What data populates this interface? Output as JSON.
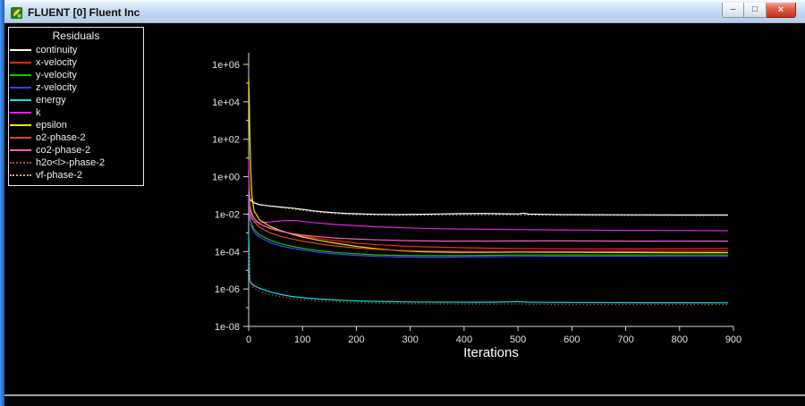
{
  "window": {
    "title": "FLUENT [0] Fluent Inc",
    "controls": {
      "minimize": "–",
      "maximize": "□",
      "close": "×"
    }
  },
  "legend": {
    "title": "Residuals",
    "items": [
      {
        "label": "continuity",
        "color": "#ffffff",
        "dash": "solid"
      },
      {
        "label": "x-velocity",
        "color": "#ff2222",
        "dash": "solid"
      },
      {
        "label": "y-velocity",
        "color": "#00cc00",
        "dash": "solid"
      },
      {
        "label": "z-velocity",
        "color": "#4040ff",
        "dash": "solid"
      },
      {
        "label": "energy",
        "color": "#00e5e5",
        "dash": "solid"
      },
      {
        "label": "k",
        "color": "#e320e3",
        "dash": "solid"
      },
      {
        "label": "epsilon",
        "color": "#e8e800",
        "dash": "solid"
      },
      {
        "label": "o2-phase-2",
        "color": "#e0481c",
        "dash": "solid"
      },
      {
        "label": "co2-phase-2",
        "color": "#f060c0",
        "dash": "solid"
      },
      {
        "label": "h2o<l>-phase-2",
        "color": "#b04838",
        "dash": "dotted"
      },
      {
        "label": "vf-phase-2",
        "color": "#c8a878",
        "dash": "dotted"
      }
    ]
  },
  "chart_data": {
    "type": "line",
    "title": "Residuals",
    "xlabel": "Iterations",
    "ylabel": "",
    "x_range": [
      0,
      900
    ],
    "ylog_range": [
      -8,
      6
    ],
    "x_ticks": [
      0,
      100,
      200,
      300,
      400,
      500,
      600,
      700,
      800,
      900
    ],
    "y_ticks": [
      "1e+06",
      "1e+04",
      "1e+02",
      "1e+00",
      "1e-02",
      "1e-04",
      "1e-06",
      "1e-08"
    ],
    "grid": false,
    "legend_position": "top-left",
    "series": [
      {
        "name": "continuity",
        "color": "#ffffff",
        "style": "solid",
        "points": [
          [
            0,
            2
          ],
          [
            2,
            0.06
          ],
          [
            5,
            0.05
          ],
          [
            10,
            0.04
          ],
          [
            20,
            0.032
          ],
          [
            40,
            0.027
          ],
          [
            60,
            0.024
          ],
          [
            80,
            0.021
          ],
          [
            100,
            0.018
          ],
          [
            120,
            0.015
          ],
          [
            140,
            0.013
          ],
          [
            160,
            0.012
          ],
          [
            180,
            0.011
          ],
          [
            200,
            0.0105
          ],
          [
            240,
            0.0097
          ],
          [
            280,
            0.0095
          ],
          [
            320,
            0.0098
          ],
          [
            360,
            0.0102
          ],
          [
            400,
            0.0106
          ],
          [
            440,
            0.0108
          ],
          [
            480,
            0.0104
          ],
          [
            500,
            0.0102
          ],
          [
            510,
            0.0112
          ],
          [
            520,
            0.01
          ],
          [
            560,
            0.0096
          ],
          [
            600,
            0.0094
          ],
          [
            700,
            0.0092
          ],
          [
            800,
            0.009
          ],
          [
            890,
            0.009
          ]
        ]
      },
      {
        "name": "x-velocity",
        "color": "#ff2222",
        "style": "solid",
        "points": [
          [
            0,
            1
          ],
          [
            2,
            0.03
          ],
          [
            5,
            0.012
          ],
          [
            10,
            0.006
          ],
          [
            20,
            0.003
          ],
          [
            40,
            0.0018
          ],
          [
            60,
            0.0012
          ],
          [
            80,
            0.0009
          ],
          [
            100,
            0.0007
          ],
          [
            130,
            0.0005
          ],
          [
            160,
            0.00038
          ],
          [
            200,
            0.00028
          ],
          [
            240,
            0.00023
          ],
          [
            280,
            0.0002
          ],
          [
            320,
            0.00018
          ],
          [
            360,
            0.00017
          ],
          [
            400,
            0.00016
          ],
          [
            450,
            0.00015
          ],
          [
            500,
            0.000145
          ],
          [
            550,
            0.00014
          ],
          [
            600,
            0.00014
          ],
          [
            700,
            0.000138
          ],
          [
            800,
            0.000142
          ],
          [
            890,
            0.000145
          ]
        ]
      },
      {
        "name": "y-velocity",
        "color": "#00cc00",
        "style": "solid",
        "points": [
          [
            0,
            0.5
          ],
          [
            2,
            0.008
          ],
          [
            5,
            0.003
          ],
          [
            10,
            0.0015
          ],
          [
            20,
            0.0008
          ],
          [
            40,
            0.0004
          ],
          [
            60,
            0.00026
          ],
          [
            80,
            0.00019
          ],
          [
            100,
            0.00015
          ],
          [
            130,
            0.00011
          ],
          [
            160,
            9e-05
          ],
          [
            200,
            7.5e-05
          ],
          [
            240,
            6.6e-05
          ],
          [
            280,
            6.2e-05
          ],
          [
            320,
            6e-05
          ],
          [
            360,
            6e-05
          ],
          [
            400,
            6.1e-05
          ],
          [
            450,
            6.3e-05
          ],
          [
            500,
            6.5e-05
          ],
          [
            600,
            6.6e-05
          ],
          [
            700,
            6.6e-05
          ],
          [
            800,
            6.5e-05
          ],
          [
            890,
            6.5e-05
          ]
        ]
      },
      {
        "name": "z-velocity",
        "color": "#4040ff",
        "style": "solid",
        "points": [
          [
            0,
            0.4
          ],
          [
            2,
            0.006
          ],
          [
            5,
            0.0022
          ],
          [
            10,
            0.0011
          ],
          [
            20,
            0.0006
          ],
          [
            40,
            0.0003
          ],
          [
            60,
            0.0002
          ],
          [
            80,
            0.00015
          ],
          [
            100,
            0.00012
          ],
          [
            130,
            9e-05
          ],
          [
            160,
            7.5e-05
          ],
          [
            200,
            6.2e-05
          ],
          [
            240,
            5.5e-05
          ],
          [
            280,
            5.1e-05
          ],
          [
            320,
            5e-05
          ],
          [
            360,
            5e-05
          ],
          [
            400,
            5.1e-05
          ],
          [
            450,
            5.3e-05
          ],
          [
            500,
            5.5e-05
          ],
          [
            600,
            5.6e-05
          ],
          [
            700,
            5.6e-05
          ],
          [
            800,
            5.5e-05
          ],
          [
            890,
            5.5e-05
          ]
        ]
      },
      {
        "name": "energy",
        "color": "#00e5e5",
        "style": "solid",
        "points": [
          [
            0,
            0.001
          ],
          [
            2,
            3e-06
          ],
          [
            5,
            2e-06
          ],
          [
            10,
            1.5e-06
          ],
          [
            20,
            1.1e-06
          ],
          [
            40,
            7e-07
          ],
          [
            60,
            5e-07
          ],
          [
            80,
            4e-07
          ],
          [
            100,
            3.4e-07
          ],
          [
            130,
            2.9e-07
          ],
          [
            160,
            2.6e-07
          ],
          [
            200,
            2.3e-07
          ],
          [
            240,
            2.15e-07
          ],
          [
            280,
            2.05e-07
          ],
          [
            320,
            2e-07
          ],
          [
            360,
            1.97e-07
          ],
          [
            400,
            1.95e-07
          ],
          [
            450,
            1.95e-07
          ],
          [
            500,
            2.1e-07
          ],
          [
            520,
            1.95e-07
          ],
          [
            560,
            1.9e-07
          ],
          [
            600,
            1.88e-07
          ],
          [
            700,
            1.85e-07
          ],
          [
            800,
            1.82e-07
          ],
          [
            890,
            1.8e-07
          ]
        ]
      },
      {
        "name": "k",
        "color": "#e320e3",
        "style": "solid",
        "points": [
          [
            0,
            8
          ],
          [
            2,
            0.015
          ],
          [
            5,
            0.006
          ],
          [
            10,
            0.0042
          ],
          [
            20,
            0.0035
          ],
          [
            40,
            0.0038
          ],
          [
            60,
            0.0044
          ],
          [
            75,
            0.0047
          ],
          [
            90,
            0.0044
          ],
          [
            110,
            0.0038
          ],
          [
            130,
            0.0033
          ],
          [
            160,
            0.0028
          ],
          [
            200,
            0.0024
          ],
          [
            240,
            0.0021
          ],
          [
            280,
            0.0019
          ],
          [
            320,
            0.00175
          ],
          [
            360,
            0.00165
          ],
          [
            400,
            0.0016
          ],
          [
            450,
            0.00155
          ],
          [
            500,
            0.0015
          ],
          [
            550,
            0.00145
          ],
          [
            600,
            0.0014
          ],
          [
            650,
            0.00137
          ],
          [
            700,
            0.00135
          ],
          [
            800,
            0.00132
          ],
          [
            890,
            0.0013
          ]
        ]
      },
      {
        "name": "epsilon",
        "color": "#e8e800",
        "style": "solid",
        "points": [
          [
            0,
            200000
          ],
          [
            1,
            20000
          ],
          [
            2,
            300
          ],
          [
            4,
            2
          ],
          [
            6,
            0.1
          ],
          [
            10,
            0.015
          ],
          [
            20,
            0.005
          ],
          [
            40,
            0.0022
          ],
          [
            60,
            0.0013
          ],
          [
            80,
            0.00085
          ],
          [
            100,
            0.0006
          ],
          [
            130,
            0.0004
          ],
          [
            160,
            0.00028
          ],
          [
            200,
            0.00019
          ],
          [
            240,
            0.00014
          ],
          [
            280,
            0.00011
          ],
          [
            320,
            9.8e-05
          ],
          [
            360,
            9.2e-05
          ],
          [
            400,
            9e-05
          ],
          [
            450,
            9.1e-05
          ],
          [
            500,
            9.3e-05
          ],
          [
            550,
            9.2e-05
          ],
          [
            600,
            9e-05
          ],
          [
            700,
            8.8e-05
          ],
          [
            800,
            8.7e-05
          ],
          [
            890,
            8.7e-05
          ]
        ]
      },
      {
        "name": "o2-phase-2",
        "color": "#e0481c",
        "style": "solid",
        "points": [
          [
            0,
            0.3
          ],
          [
            2,
            0.02
          ],
          [
            5,
            0.008
          ],
          [
            10,
            0.004
          ],
          [
            20,
            0.002
          ],
          [
            40,
            0.001
          ],
          [
            60,
            0.00065
          ],
          [
            80,
            0.00047
          ],
          [
            100,
            0.00036
          ],
          [
            130,
            0.00026
          ],
          [
            160,
            0.0002
          ],
          [
            200,
            0.000155
          ],
          [
            240,
            0.00013
          ],
          [
            280,
            0.000115
          ],
          [
            320,
            0.000107
          ],
          [
            360,
            0.000103
          ],
          [
            400,
            0.000101
          ],
          [
            450,
            0.0001
          ],
          [
            500,
            0.000101
          ],
          [
            600,
            0.000102
          ],
          [
            700,
            0.000103
          ],
          [
            800,
            0.000104
          ],
          [
            890,
            0.000105
          ]
        ]
      },
      {
        "name": "co2-phase-2",
        "color": "#f060c0",
        "style": "solid",
        "points": [
          [
            0,
            0.2
          ],
          [
            2,
            0.03
          ],
          [
            5,
            0.012
          ],
          [
            10,
            0.006
          ],
          [
            20,
            0.003
          ],
          [
            40,
            0.0017
          ],
          [
            60,
            0.0012
          ],
          [
            80,
            0.00092
          ],
          [
            100,
            0.00076
          ],
          [
            130,
            0.00062
          ],
          [
            160,
            0.00053
          ],
          [
            200,
            0.00046
          ],
          [
            240,
            0.00042
          ],
          [
            280,
            0.00039
          ],
          [
            320,
            0.00037
          ],
          [
            360,
            0.00036
          ],
          [
            400,
            0.00036
          ],
          [
            450,
            0.00036
          ],
          [
            500,
            0.00037
          ],
          [
            600,
            0.00037
          ],
          [
            700,
            0.00036
          ],
          [
            800,
            0.00036
          ],
          [
            890,
            0.00036
          ]
        ]
      },
      {
        "name": "h2o-l-phase-2",
        "color": "#b04838",
        "style": "dotted",
        "points": [
          [
            0,
            0.0001
          ],
          [
            2,
            3e-06
          ],
          [
            5,
            1.6e-06
          ],
          [
            10,
            1.1e-06
          ],
          [
            20,
            7.5e-07
          ],
          [
            40,
            5e-07
          ],
          [
            60,
            3.8e-07
          ],
          [
            80,
            3.1e-07
          ],
          [
            100,
            2.7e-07
          ],
          [
            130,
            2.3e-07
          ],
          [
            160,
            2.05e-07
          ],
          [
            200,
            1.85e-07
          ],
          [
            240,
            1.72e-07
          ],
          [
            280,
            1.64e-07
          ],
          [
            320,
            1.6e-07
          ],
          [
            360,
            1.57e-07
          ],
          [
            400,
            1.55e-07
          ],
          [
            450,
            1.53e-07
          ],
          [
            500,
            1.6e-07
          ],
          [
            520,
            1.52e-07
          ],
          [
            600,
            1.5e-07
          ],
          [
            700,
            1.48e-07
          ],
          [
            800,
            1.47e-07
          ],
          [
            890,
            1.46e-07
          ]
        ]
      },
      {
        "name": "vf-phase-2",
        "color": "#c8a878",
        "style": "dotted",
        "points": [
          [
            0,
            0.15
          ],
          [
            2,
            0.09
          ],
          [
            5,
            0.06
          ],
          [
            10,
            0.045
          ],
          [
            20,
            0.034
          ],
          [
            40,
            0.026
          ],
          [
            60,
            0.022
          ],
          [
            80,
            0.019
          ],
          [
            100,
            0.016
          ],
          [
            120,
            0.0135
          ],
          [
            140,
            0.0118
          ],
          [
            160,
            0.0106
          ],
          [
            180,
            0.0098
          ],
          [
            200,
            0.0093
          ],
          [
            240,
            0.0088
          ],
          [
            280,
            0.0086
          ],
          [
            320,
            0.0087
          ],
          [
            360,
            0.0089
          ],
          [
            400,
            0.0092
          ],
          [
            440,
            0.0094
          ],
          [
            480,
            0.0092
          ],
          [
            520,
            0.0089
          ],
          [
            560,
            0.0087
          ],
          [
            600,
            0.0086
          ],
          [
            700,
            0.0084
          ],
          [
            800,
            0.0083
          ],
          [
            890,
            0.0083
          ]
        ]
      }
    ]
  }
}
